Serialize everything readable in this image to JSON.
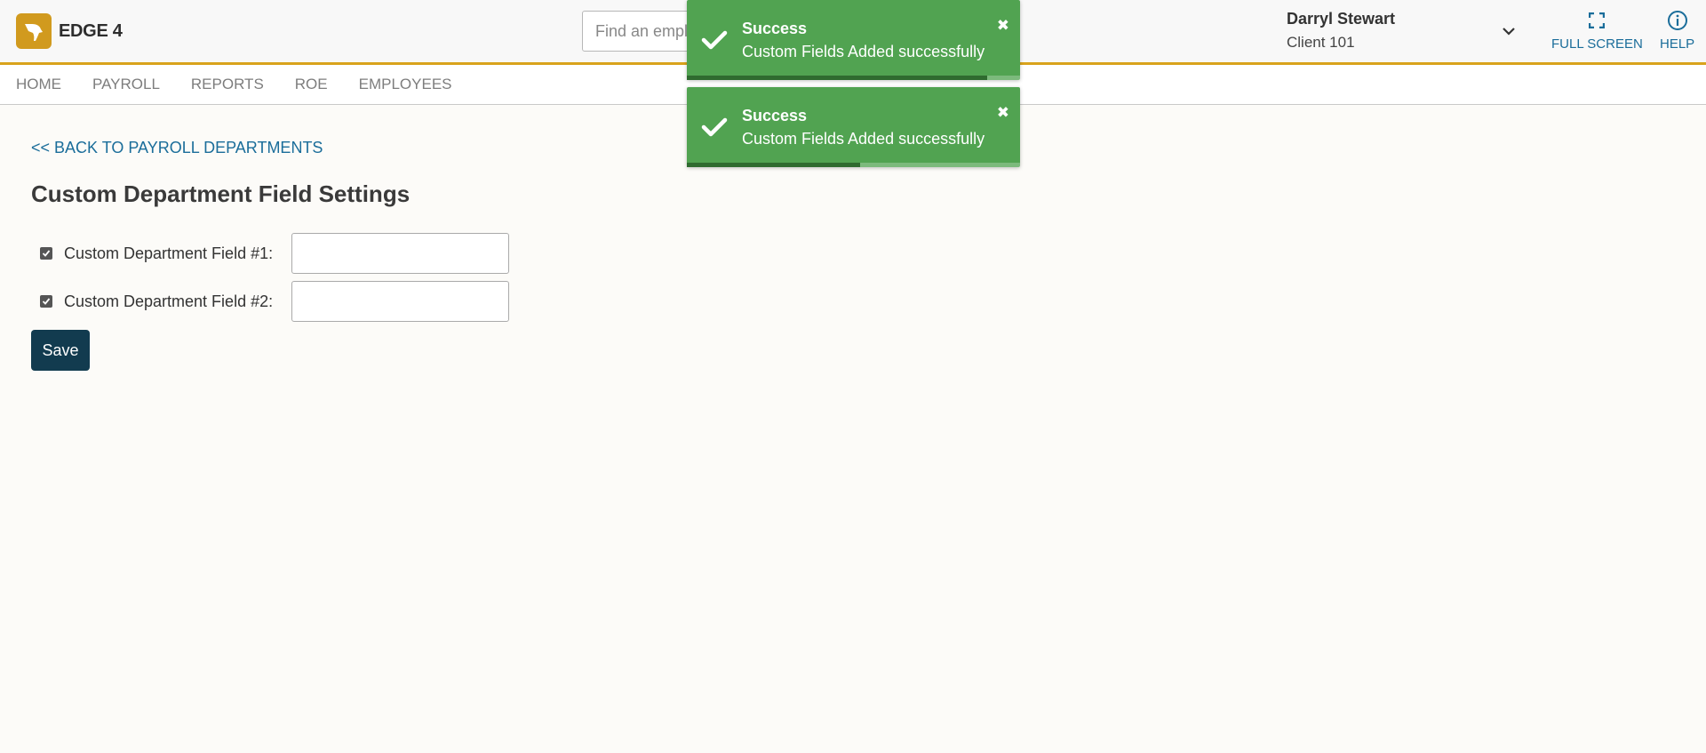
{
  "header": {
    "logo_text": "EDGE 4",
    "search_placeholder": "Find an employee",
    "user_name": "Darryl Stewart",
    "client_name": "Client 101",
    "fullscreen_label": "FULL SCREEN",
    "help_label": "HELP"
  },
  "nav": {
    "items": [
      {
        "label": "HOME"
      },
      {
        "label": "PAYROLL"
      },
      {
        "label": "REPORTS"
      },
      {
        "label": "ROE"
      },
      {
        "label": "EMPLOYEES"
      }
    ]
  },
  "main": {
    "back_link": "<< BACK TO PAYROLL DEPARTMENTS",
    "title": "Custom Department Field Settings",
    "fields": [
      {
        "label": "Custom Department Field #1:",
        "checked": true,
        "value": ""
      },
      {
        "label": "Custom Department Field #2:",
        "checked": true,
        "value": ""
      }
    ],
    "save_label": "Save"
  },
  "toasts": [
    {
      "title": "Success",
      "message": "Custom Fields Added successfully",
      "progress": 0.9
    },
    {
      "title": "Success",
      "message": "Custom Fields Added successfully",
      "progress": 0.52
    }
  ],
  "colors": {
    "accent_gold": "#d9a31c",
    "link_blue": "#1a6d9a",
    "save_button": "#123b4f",
    "toast_green": "#51a351"
  }
}
